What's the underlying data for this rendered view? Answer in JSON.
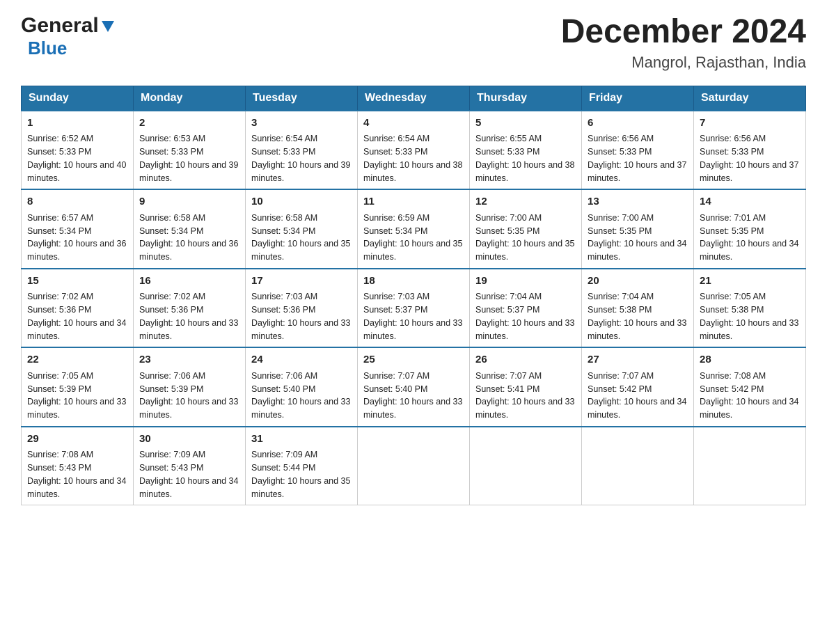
{
  "header": {
    "logo_general": "General",
    "logo_blue": "Blue",
    "title": "December 2024",
    "subtitle": "Mangrol, Rajasthan, India"
  },
  "weekdays": [
    "Sunday",
    "Monday",
    "Tuesday",
    "Wednesday",
    "Thursday",
    "Friday",
    "Saturday"
  ],
  "weeks": [
    [
      {
        "day": "1",
        "sunrise": "Sunrise: 6:52 AM",
        "sunset": "Sunset: 5:33 PM",
        "daylight": "Daylight: 10 hours and 40 minutes."
      },
      {
        "day": "2",
        "sunrise": "Sunrise: 6:53 AM",
        "sunset": "Sunset: 5:33 PM",
        "daylight": "Daylight: 10 hours and 39 minutes."
      },
      {
        "day": "3",
        "sunrise": "Sunrise: 6:54 AM",
        "sunset": "Sunset: 5:33 PM",
        "daylight": "Daylight: 10 hours and 39 minutes."
      },
      {
        "day": "4",
        "sunrise": "Sunrise: 6:54 AM",
        "sunset": "Sunset: 5:33 PM",
        "daylight": "Daylight: 10 hours and 38 minutes."
      },
      {
        "day": "5",
        "sunrise": "Sunrise: 6:55 AM",
        "sunset": "Sunset: 5:33 PM",
        "daylight": "Daylight: 10 hours and 38 minutes."
      },
      {
        "day": "6",
        "sunrise": "Sunrise: 6:56 AM",
        "sunset": "Sunset: 5:33 PM",
        "daylight": "Daylight: 10 hours and 37 minutes."
      },
      {
        "day": "7",
        "sunrise": "Sunrise: 6:56 AM",
        "sunset": "Sunset: 5:33 PM",
        "daylight": "Daylight: 10 hours and 37 minutes."
      }
    ],
    [
      {
        "day": "8",
        "sunrise": "Sunrise: 6:57 AM",
        "sunset": "Sunset: 5:34 PM",
        "daylight": "Daylight: 10 hours and 36 minutes."
      },
      {
        "day": "9",
        "sunrise": "Sunrise: 6:58 AM",
        "sunset": "Sunset: 5:34 PM",
        "daylight": "Daylight: 10 hours and 36 minutes."
      },
      {
        "day": "10",
        "sunrise": "Sunrise: 6:58 AM",
        "sunset": "Sunset: 5:34 PM",
        "daylight": "Daylight: 10 hours and 35 minutes."
      },
      {
        "day": "11",
        "sunrise": "Sunrise: 6:59 AM",
        "sunset": "Sunset: 5:34 PM",
        "daylight": "Daylight: 10 hours and 35 minutes."
      },
      {
        "day": "12",
        "sunrise": "Sunrise: 7:00 AM",
        "sunset": "Sunset: 5:35 PM",
        "daylight": "Daylight: 10 hours and 35 minutes."
      },
      {
        "day": "13",
        "sunrise": "Sunrise: 7:00 AM",
        "sunset": "Sunset: 5:35 PM",
        "daylight": "Daylight: 10 hours and 34 minutes."
      },
      {
        "day": "14",
        "sunrise": "Sunrise: 7:01 AM",
        "sunset": "Sunset: 5:35 PM",
        "daylight": "Daylight: 10 hours and 34 minutes."
      }
    ],
    [
      {
        "day": "15",
        "sunrise": "Sunrise: 7:02 AM",
        "sunset": "Sunset: 5:36 PM",
        "daylight": "Daylight: 10 hours and 34 minutes."
      },
      {
        "day": "16",
        "sunrise": "Sunrise: 7:02 AM",
        "sunset": "Sunset: 5:36 PM",
        "daylight": "Daylight: 10 hours and 33 minutes."
      },
      {
        "day": "17",
        "sunrise": "Sunrise: 7:03 AM",
        "sunset": "Sunset: 5:36 PM",
        "daylight": "Daylight: 10 hours and 33 minutes."
      },
      {
        "day": "18",
        "sunrise": "Sunrise: 7:03 AM",
        "sunset": "Sunset: 5:37 PM",
        "daylight": "Daylight: 10 hours and 33 minutes."
      },
      {
        "day": "19",
        "sunrise": "Sunrise: 7:04 AM",
        "sunset": "Sunset: 5:37 PM",
        "daylight": "Daylight: 10 hours and 33 minutes."
      },
      {
        "day": "20",
        "sunrise": "Sunrise: 7:04 AM",
        "sunset": "Sunset: 5:38 PM",
        "daylight": "Daylight: 10 hours and 33 minutes."
      },
      {
        "day": "21",
        "sunrise": "Sunrise: 7:05 AM",
        "sunset": "Sunset: 5:38 PM",
        "daylight": "Daylight: 10 hours and 33 minutes."
      }
    ],
    [
      {
        "day": "22",
        "sunrise": "Sunrise: 7:05 AM",
        "sunset": "Sunset: 5:39 PM",
        "daylight": "Daylight: 10 hours and 33 minutes."
      },
      {
        "day": "23",
        "sunrise": "Sunrise: 7:06 AM",
        "sunset": "Sunset: 5:39 PM",
        "daylight": "Daylight: 10 hours and 33 minutes."
      },
      {
        "day": "24",
        "sunrise": "Sunrise: 7:06 AM",
        "sunset": "Sunset: 5:40 PM",
        "daylight": "Daylight: 10 hours and 33 minutes."
      },
      {
        "day": "25",
        "sunrise": "Sunrise: 7:07 AM",
        "sunset": "Sunset: 5:40 PM",
        "daylight": "Daylight: 10 hours and 33 minutes."
      },
      {
        "day": "26",
        "sunrise": "Sunrise: 7:07 AM",
        "sunset": "Sunset: 5:41 PM",
        "daylight": "Daylight: 10 hours and 33 minutes."
      },
      {
        "day": "27",
        "sunrise": "Sunrise: 7:07 AM",
        "sunset": "Sunset: 5:42 PM",
        "daylight": "Daylight: 10 hours and 34 minutes."
      },
      {
        "day": "28",
        "sunrise": "Sunrise: 7:08 AM",
        "sunset": "Sunset: 5:42 PM",
        "daylight": "Daylight: 10 hours and 34 minutes."
      }
    ],
    [
      {
        "day": "29",
        "sunrise": "Sunrise: 7:08 AM",
        "sunset": "Sunset: 5:43 PM",
        "daylight": "Daylight: 10 hours and 34 minutes."
      },
      {
        "day": "30",
        "sunrise": "Sunrise: 7:09 AM",
        "sunset": "Sunset: 5:43 PM",
        "daylight": "Daylight: 10 hours and 34 minutes."
      },
      {
        "day": "31",
        "sunrise": "Sunrise: 7:09 AM",
        "sunset": "Sunset: 5:44 PM",
        "daylight": "Daylight: 10 hours and 35 minutes."
      },
      null,
      null,
      null,
      null
    ]
  ]
}
